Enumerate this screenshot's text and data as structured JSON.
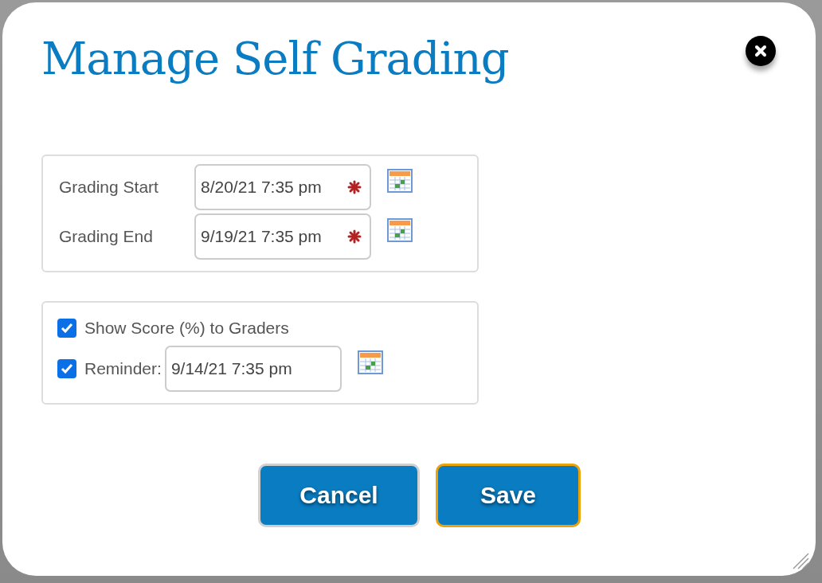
{
  "dialog": {
    "title": "Manage Self Grading"
  },
  "date_fields": [
    {
      "label": "Grading Start",
      "value": "8/20/21 7:35 pm",
      "required": true
    },
    {
      "label": "Grading End",
      "value": "9/19/21 7:35 pm",
      "required": true
    }
  ],
  "options": [
    {
      "kind": "checkbox",
      "label": "Show Score (%) to Graders",
      "checked": true
    },
    {
      "kind": "date",
      "label": "Reminder:",
      "checked": true,
      "value": "9/14/21 7:35 pm"
    }
  ],
  "buttons": [
    {
      "label": "Cancel",
      "focused": false
    },
    {
      "label": "Save",
      "focused": true
    }
  ]
}
